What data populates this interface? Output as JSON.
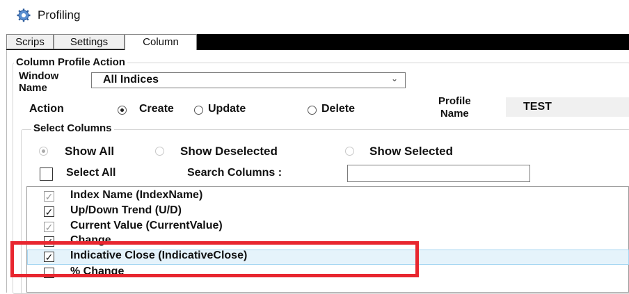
{
  "window": {
    "title": "Profiling",
    "icon": "gear-icon"
  },
  "tabs": [
    {
      "label": "Scrips",
      "active": false
    },
    {
      "label": "Settings",
      "active": false
    },
    {
      "label": "Column",
      "active": true
    }
  ],
  "column_profile_action": {
    "legend": "Column Profile Action",
    "window_name_label_line1": "Window",
    "window_name_label_line2": "Name",
    "window_name_value": "All Indices",
    "action_label": "Action",
    "actions": [
      {
        "label": "Create",
        "selected": true
      },
      {
        "label": "Update",
        "selected": false
      },
      {
        "label": "Delete",
        "selected": false
      }
    ],
    "profile_name_label_line1": "Profile",
    "profile_name_label_line2": "Name",
    "profile_name_value": "TEST"
  },
  "select_columns": {
    "legend": "Select Columns",
    "filters": [
      {
        "label": "Show All",
        "selected": true
      },
      {
        "label": "Show Deselected",
        "selected": false
      },
      {
        "label": "Show Selected",
        "selected": false
      }
    ],
    "select_all_label": "Select All",
    "search_label": "Search Columns :",
    "search_value": "",
    "items": [
      {
        "label": "Index Name (IndexName)",
        "checked": true,
        "enabled": false
      },
      {
        "label": "Up/Down Trend (U/D)",
        "checked": true,
        "enabled": true
      },
      {
        "label": "Current Value (CurrentValue)",
        "checked": true,
        "enabled": false
      },
      {
        "label": "Change",
        "checked": true,
        "enabled": true
      },
      {
        "label": "Indicative Close (IndicativeClose)",
        "checked": true,
        "enabled": true,
        "selected": true
      },
      {
        "label": "% Change",
        "checked": false,
        "enabled": true
      }
    ]
  },
  "colors": {
    "highlight": "#e8262f",
    "selection": "#e5f3fb",
    "tab_strip": "#000000"
  }
}
